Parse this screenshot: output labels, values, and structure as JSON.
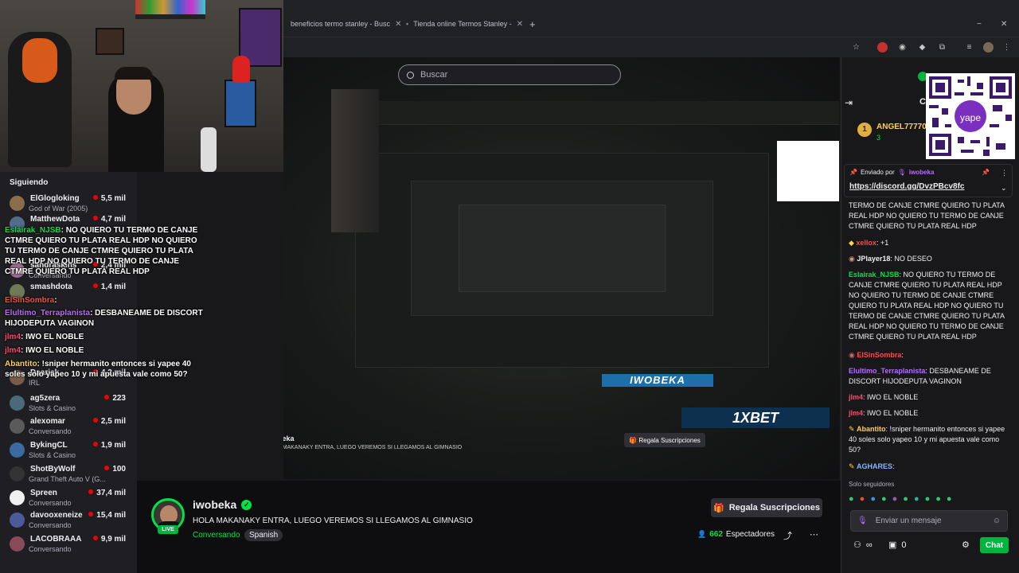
{
  "browser": {
    "tabs": [
      {
        "label": "beneficios termo stanley - Busc"
      },
      {
        "label": "Tienda online Termos Stanley -"
      }
    ],
    "new_tab": "+",
    "search_placeholder": "Buscar"
  },
  "sidebar": {
    "heading": "Siguiendo",
    "channels": [
      {
        "name": "ElGlogloking",
        "game": "God of War (2005)",
        "viewers": "5,5 mil",
        "color": "#8a6d4a"
      },
      {
        "name": "MatthewDota",
        "game": "",
        "viewers": "4,7 mil",
        "color": "#556b8a"
      },
      {
        "name": "sandraskins",
        "game": "Conversando",
        "viewers": "2,4 mil",
        "color": "#9a6d8c"
      },
      {
        "name": "smashdota",
        "game": "",
        "viewers": "1,4 mil",
        "color": "#6d7a55"
      },
      {
        "name": "Daarick",
        "game": "IRL",
        "viewers": "4,2 mil",
        "color": "#7a5a4a"
      },
      {
        "name": "ag5zera",
        "game": "Slots & Casino",
        "viewers": "223",
        "color": "#4a6a7a"
      },
      {
        "name": "alexomar",
        "game": "Conversando",
        "viewers": "2,5 mil",
        "color": "#5a5a5a"
      },
      {
        "name": "BykingCL",
        "game": "Slots & Casino",
        "viewers": "1,9 mil",
        "color": "#3a6aa0"
      },
      {
        "name": "ShotByWolf",
        "game": "Grand Theft Auto V (G...",
        "viewers": "100",
        "color": "#333333"
      },
      {
        "name": "Spreen",
        "game": "Conversando",
        "viewers": "37,4 mil",
        "color": "#f0f0f0"
      },
      {
        "name": "davooxeneize",
        "game": "Conversando",
        "viewers": "15,4 mil",
        "color": "#4a5a9a"
      },
      {
        "name": "LACOBRAAA",
        "game": "Conversando",
        "viewers": "9,9 mil",
        "color": "#8a4a5a"
      }
    ]
  },
  "overlay_chat": [
    {
      "user": "Eslairak_NJSB",
      "user_color": "#00e346",
      "text": ": NO QUIERO TU TERMO DE CANJE CTMRE QUIERO TU PLATA REAL HDP NO QUIERO TU TERMO DE CANJE CTMRE QUIERO TU PLATA REAL HDP NO QUIERO TU TERMO DE CANJE CTMRE QUIERO TU PLATA REAL HDP"
    },
    {
      "user": "ElSinSombra",
      "user_color": "#ff4a4a",
      "text": ":"
    },
    {
      "user": "Elultimo_Terraplanista",
      "user_color": "#b96bff",
      "text": ": DESBANEAME DE DISCORT HIJODEPUTA VAGINON"
    },
    {
      "user": "jlm4",
      "user_color": "#ff4a6a",
      "text": ": IWO EL NOBLE"
    },
    {
      "user": "jlm4",
      "user_color": "#ff4a6a",
      "text": ": IWO EL NOBLE"
    },
    {
      "user": "Abantito",
      "user_color": "#ffd24a",
      "text": ": !sniper hermanito entonces si yapee 40 soles solo yapeo 10 y mi apuesta vale como 50?"
    }
  ],
  "stream": {
    "channel": "iwobeka",
    "title": "HOLA MAKANAKY ENTRA, LUEGO VEREMOS SI LLEGAMOS AL GIMNASIO",
    "category": "Conversando",
    "tag": "Spanish",
    "live_badge": "LIVE",
    "gift_button": "Regala Suscripciones",
    "viewers": "662",
    "viewers_label": "Espectadores"
  },
  "player_overlay": {
    "banner": "IWOBEKA",
    "sponsor": "1XBET"
  },
  "chat": {
    "top_user": "ANGEL77770",
    "top_user_count": "3",
    "pinned_by_label": "Enviado por",
    "pinned_by_user": "iwobeka",
    "pinned_link": "https://discord.gg/DvzPBcv8fc",
    "messages": [
      {
        "user": "",
        "user_color": "#efeff1",
        "text": "TERMO DE CANJE CTMRE QUIERO TU PLATA REAL HDP NO QUIERO TU TERMO DE CANJE CTMRE QUIERO TU PLATA REAL HDP"
      },
      {
        "user": "xellox",
        "user_color": "#ff4a4a",
        "text": ": +1"
      },
      {
        "user": "JPlayer18",
        "user_color": "#efeff1",
        "text": ": NO DESEO"
      },
      {
        "user": "Eslairak_NJSB",
        "user_color": "#00e346",
        "text": ": NO QUIERO TU TERMO DE CANJE CTMRE QUIERO TU PLATA REAL HDP NO QUIERO TU TERMO DE CANJE CTMRE QUIERO TU PLATA REAL HDP NO QUIERO TU TERMO DE CANJE CTMRE QUIERO TU PLATA REAL HDP NO QUIERO TU TERMO DE CANJE CTMRE QUIERO TU PLATA REAL HDP"
      },
      {
        "user": "ElSinSombra",
        "user_color": "#ff4a4a",
        "text": ":"
      },
      {
        "user": "Elultimo_Terraplanista",
        "user_color": "#b96bff",
        "text": ": DESBANEAME DE DISCORT HIJODEPUTA VAGINON"
      },
      {
        "user": "jlm4",
        "user_color": "#ff4a6a",
        "text": ": IWO EL NOBLE"
      },
      {
        "user": "jlm4",
        "user_color": "#ff4a6a",
        "text": ": IWO EL NOBLE"
      },
      {
        "user": "Abantito",
        "user_color": "#ffd24a",
        "text": ": !sniper hermanito entonces si yapee 40 soles solo yapeo 10 y mi apuesta vale como 50?"
      },
      {
        "user": "AGHARES",
        "user_color": "#8ab4ff",
        "text": ":"
      }
    ],
    "followers_only": "Solo seguidores",
    "input_placeholder": "Enviar un mensaje",
    "points": "0",
    "chat_button": "Chat"
  }
}
